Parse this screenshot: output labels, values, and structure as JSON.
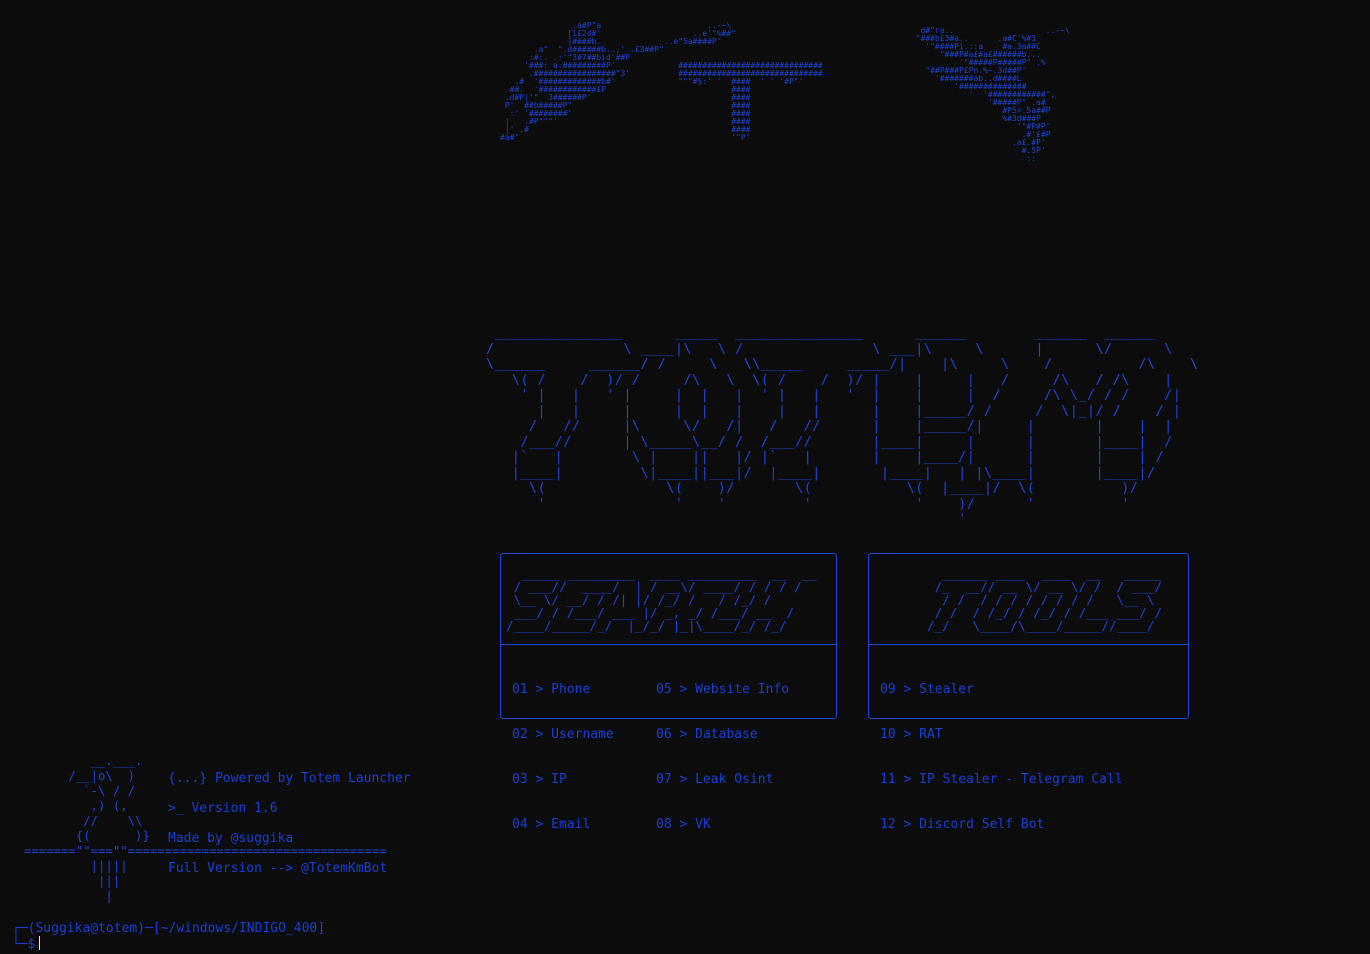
{
  "art": {
    "figure": "               .a#P\"a                      ..-~\\\n              [i£2d#'                   ..e'\"%##\"\n              ]####b.             ..e\"5a####P'\n       .a\"  \".d######b..,' .£3##P\"\n      :#:. .:'\"3#7##bid'##P\n     '###: a:#########P'             ##############################\n      .#################\"3'          ##############################\n   .#  '#############b#'             \"\"\"#§:' '  ####  ' ' '#P\"'\n  ##.  '############£P                          ####\n .d#P|'\"  3######P'                             ####\n P'  ##b#####P\"                                 ####\n  :' '########'                                 ####\n |   .#P\"\"\"'                                    ####\n |' .#                                          ####\n#a#'                                            '\"P'",
    "figure_right": "   d#\"ra..                   ..-~\\\n  \"###b£3#a..      .a#C'%#3\n    '\"####Pi.::a    #a.3a##C\n       \"###P#a£#a£######b...\n           '\"#####P#####P\" .%\n    \"##P###P£Pn.%~.3d##P'\n      '#######ab..d####L\n          '##############\n             '  '############\",\n                 '#####P\" .a#\n                    #P5>.5a##P\n                    %#3d###P\n                       '\"#P#P'\n                        .#'£#P\n                      .a£.#P'\n                        #.5P'\n                         ::",
    "logo": " _______________      _____  _______________      ______        ______  ______\n/               \\ ____|\\   \\ /               \\ ___|\\     \\      |      \\/      \\\n\\______     ______/ /     \\   \\\\_____     _____/|    |\\     \\    /          /\\    \\\n   \\( /    /  )/ /     /\\   \\  \\( /    /  )/ |    |     |   /     /\\   / /\\    |\n    ' |   |   ' |     |  |   |  ' |   |   '  |    |     |  /     /\\ \\_/ / /    /|\n      |   |     |     |  |   |    |   |      |    |_____/ /     /  \\|_|/ /    / |\n     /   //     |\\     \\/   /|   /   //      |    |_____/|     |       |    |  |\n    /___//      | \\_____\\__/ /  /___//       |____|     |      |       |____|  /\n   |`   |        \\ |    ||   |/ |`   |       |    |____/|      |       |    | /\n   |____|         \\|____||___|/  |____|       |____|   | |\\____|       |____|/\n     \\(              \\(    )/       \\(           \\(  |____|/  \\(          )/\n      '               '    '         '            '    )/      '          '\n                                                       '",
    "search_banner": "  _____ _________  ____ _________  __  __\n / ___//  ____/  | / __\\/ ____/ / / / /\n \\__ \\/ __/ / /| |/ /_/ /   / /_/ /\n ___/ / /___/ ___ |/ _, _/ /___/ __  /\n/____/_____/_/  |_/_/ |_|\\____/_/ /_/",
    "tools_banner": "  ______ ____  ____  __   _____\n /_  __// __ \\/ __ \\/ /  / ___/\n  / /  / / / / / / / /   \\__ \\\n / /  / /_/ / /_/ / /___ ___/ /\n/_/   \\____/\\____/_____//____/",
    "info_art": "         __.___.\n      /__|o\\  )\n        `-\\ / /\n         ,) (,\n        //    \\\\\n       {(      )}\n=======\"\"===\"\"===================================\n         |||||\n          |||\n           |"
  },
  "search_menu": {
    "col1": [
      "01 > Phone",
      "02 > Username",
      "03 > IP",
      "04 > Email"
    ],
    "col2": [
      "05 > Website Info",
      "06 > Database",
      "07 > Leak Osint",
      "08 > VK"
    ]
  },
  "tools_menu": {
    "items": [
      "09 > Stealer",
      "10 > RAT",
      "11 > IP Stealer - Telegram Call",
      "12 > Discord Self Bot"
    ]
  },
  "info": {
    "powered": "{...} Powered by Totem Launcher",
    "version": ">_ Version 1.6",
    "made_by": "Made by @suggika",
    "full_version": "Full Version --> @TotemKmBot"
  },
  "prompt": {
    "line1": "┌─(Suggika@totem)─[~/windows/INDIGO_400]",
    "line2": "└─$"
  },
  "colors": {
    "background": "#0c0c0c",
    "accent": "#1f44d8",
    "cursor": "#e8e8e8"
  }
}
